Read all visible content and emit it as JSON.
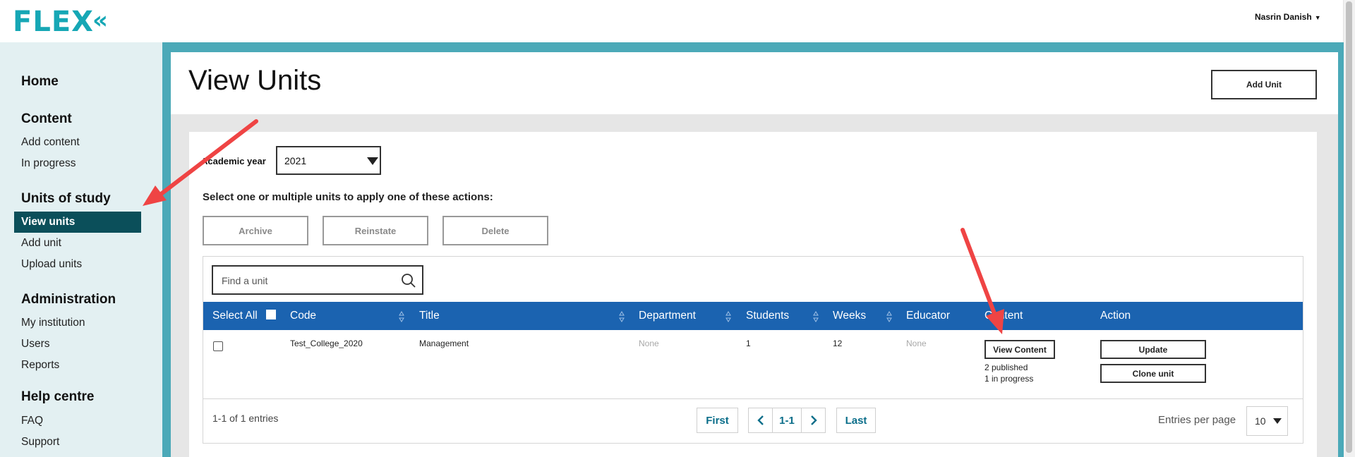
{
  "app": {
    "logo": "FLEX",
    "logo_mark": "«",
    "user_name": "Nasrin Danish"
  },
  "sidebar": {
    "home": "Home",
    "content_heading": "Content",
    "content_items": [
      "Add content",
      "In progress"
    ],
    "units_heading": "Units of study",
    "units_active": "View units",
    "units_items": [
      "Add unit",
      "Upload units"
    ],
    "admin_heading": "Administration",
    "admin_items": [
      "My institution",
      "Users",
      "Reports"
    ],
    "help_heading": "Help centre",
    "help_items": [
      "FAQ",
      "Support"
    ]
  },
  "page": {
    "title": "View Units",
    "add_unit_label": "Add Unit"
  },
  "filters": {
    "academic_year_label": "Academic year",
    "academic_year_value": "2021"
  },
  "actions": {
    "instruction": "Select one or multiple units to apply one of these actions:",
    "archive": "Archive",
    "reinstate": "Reinstate",
    "delete": "Delete"
  },
  "search": {
    "placeholder": "Find a unit"
  },
  "table": {
    "headers": {
      "select_all": "Select All",
      "code": "Code",
      "title": "Title",
      "department": "Department",
      "students": "Students",
      "weeks": "Weeks",
      "educator": "Educator",
      "content": "Content",
      "action": "Action"
    },
    "rows": [
      {
        "code": "Test_College_2020",
        "title": "Management",
        "department": "None",
        "students": "1",
        "weeks": "12",
        "educator": "None",
        "view_content": "View Content",
        "published": "2 published",
        "in_progress": "1 in progress",
        "update": "Update",
        "clone": "Clone unit"
      }
    ]
  },
  "pagination": {
    "info": "1-1 of 1 entries",
    "first": "First",
    "current": "1-1",
    "last": "Last",
    "prev_icon": "chevron-left-icon",
    "next_icon": "chevron-right-icon",
    "entries_label": "Entries per page",
    "entries_value": "10"
  },
  "colors": {
    "brand": "#16a7b5",
    "frame": "#4ba9b8",
    "sidebar_bg": "#e3f0f2",
    "active_nav": "#0b4f5a",
    "table_header": "#1b63b0",
    "annotation_arrow": "#ef4444"
  }
}
